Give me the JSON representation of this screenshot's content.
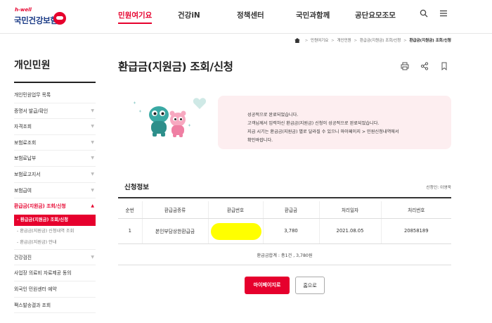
{
  "header": {
    "logo_hwell": "h-well",
    "logo_name": "국민건강보험",
    "nav": [
      "민원여기요",
      "건강iN",
      "정책센터",
      "국민과함께",
      "공단요모조모"
    ]
  },
  "breadcrumb": {
    "items": [
      "민원여기요",
      "개인민원",
      "환급금(지원금) 조회/신청"
    ],
    "current": "환급금(지원금) 조회/신청"
  },
  "sidebar": {
    "title": "개인민원",
    "items": [
      {
        "label": "개인민원업무 목록",
        "chevron": false
      },
      {
        "label": "증명서 발급/확인",
        "chevron": true
      },
      {
        "label": "자격조회",
        "chevron": true
      },
      {
        "label": "보험료조회",
        "chevron": true
      },
      {
        "label": "보험료납부",
        "chevron": true
      },
      {
        "label": "보험료고지서",
        "chevron": true
      },
      {
        "label": "보험급여",
        "chevron": true
      },
      {
        "label": "환급금(지원금) 조회/신청",
        "chevron": true,
        "active": true
      }
    ],
    "sub_items": [
      {
        "label": "환급금(지원금) 조회/신청",
        "active": true
      },
      {
        "label": "환급금(지원금) 신청내역 조회",
        "active": false
      },
      {
        "label": "환급금(지원금) 안내",
        "active": false
      }
    ],
    "after_items": [
      {
        "label": "건강검진",
        "chevron": true
      },
      {
        "label": "사업장 의료비 자료제공 동의",
        "chevron": false
      },
      {
        "label": "외국인 민원센터 예약",
        "chevron": false
      },
      {
        "label": "팩스발송결과 조회",
        "chevron": false
      }
    ]
  },
  "main": {
    "title": "환급금(지원금) 조회/신청",
    "notice_lines": [
      "성공적으로 완료되었습니다.",
      "고객님께서 입력하신 환급금(지원금) 신청이 성공적으로 완료되었습니다.",
      "지급 시기는 환급금(지원금) 별로 달라질 수 있으니 마이페이지 > 민원신청내역에서",
      "확인바랍니다."
    ],
    "section_title": "신청정보",
    "applicant_label": "신청인: 이영욱",
    "table": {
      "headers": [
        "순번",
        "환급금종류",
        "환급번호",
        "환급금",
        "처리일자",
        "처리번호"
      ],
      "rows": [
        [
          "1",
          "본인부담상한환급금",
          "",
          "3,780",
          "2021.08.05",
          "20858189"
        ]
      ]
    },
    "total_text": "환급금합계 : 총1건 , 3,780원",
    "buttons": {
      "mypage": "마이페이지로",
      "home": "홈으로"
    }
  },
  "colors": {
    "accent": "#e6002d",
    "brand_blue": "#1b3b86",
    "notice_bg": "#fdeef0"
  },
  "icons": [
    "search-icon",
    "menu-icon",
    "print-icon",
    "share-icon",
    "bookmark-icon",
    "home-icon"
  ]
}
